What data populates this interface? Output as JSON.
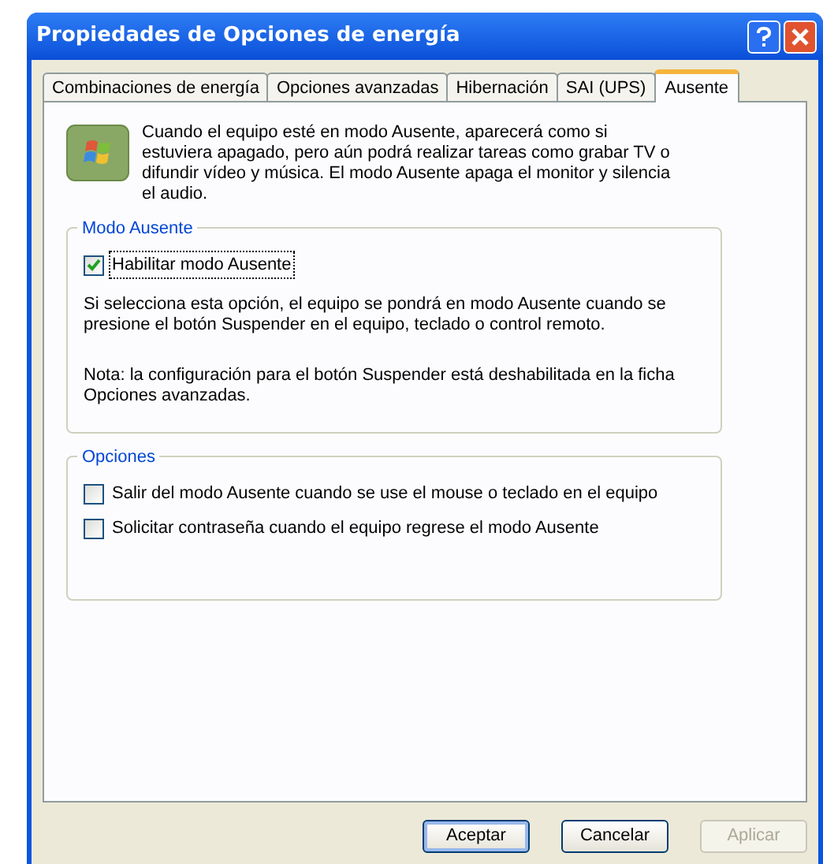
{
  "window": {
    "title": "Propiedades de Opciones de energía"
  },
  "tabs": [
    {
      "label": "Combinaciones de energía",
      "selected": false
    },
    {
      "label": "Opciones avanzadas",
      "selected": false
    },
    {
      "label": "Hibernación",
      "selected": false
    },
    {
      "label": "SAI (UPS)",
      "selected": false
    },
    {
      "label": "Ausente",
      "selected": true
    }
  ],
  "intro": "Cuando el equipo esté en modo Ausente, aparecerá como si estuviera apagado, pero aún podrá realizar tareas como grabar TV o difundir vídeo y música. El modo Ausente apaga el monitor y silencia el audio.",
  "groups": [
    {
      "title": "Modo Ausente",
      "checkboxes": [
        {
          "label": "Habilitar modo Ausente",
          "checked": true,
          "focused": true
        }
      ],
      "notes": [
        "Si selecciona esta opción, el equipo se pondrá en modo Ausente cuando se presione el botón Suspender en el equipo, teclado o control remoto.",
        "Nota: la configuración para el botón Suspender está deshabilitada en la ficha Opciones avanzadas."
      ]
    },
    {
      "title": "Opciones",
      "checkboxes": [
        {
          "label": "Salir del modo Ausente cuando se use el mouse o teclado en el equipo",
          "checked": false,
          "focused": false
        },
        {
          "label": "Solicitar contraseña cuando el equipo regrese el modo Ausente",
          "checked": false,
          "focused": false
        }
      ]
    }
  ],
  "buttons": [
    {
      "label": "Aceptar",
      "disabled": false,
      "default": true
    },
    {
      "label": "Cancelar",
      "disabled": false,
      "default": false
    },
    {
      "label": "Aplicar",
      "disabled": true,
      "default": false
    }
  ]
}
